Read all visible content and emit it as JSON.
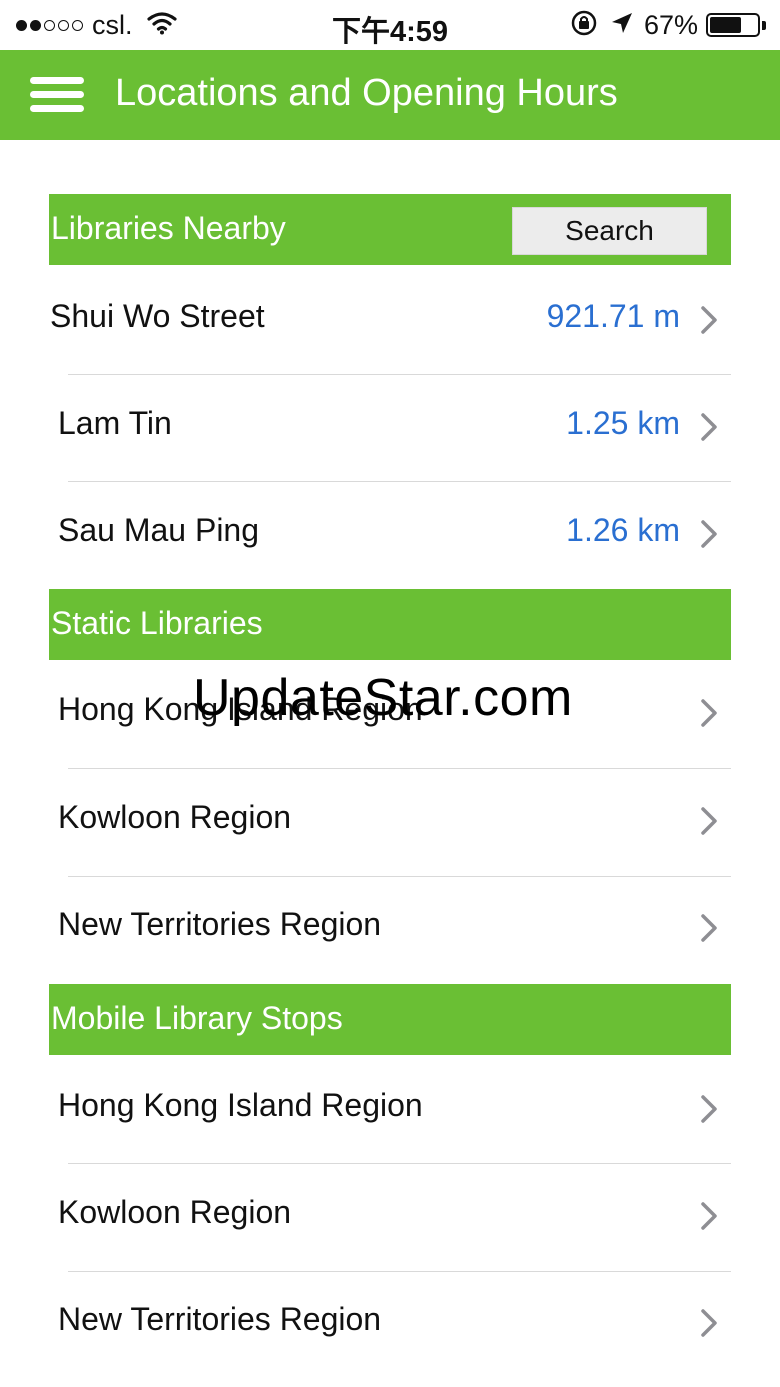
{
  "status_bar": {
    "carrier": "csl.",
    "time": "下午4:59",
    "battery": "67%",
    "battery_level": 0.67,
    "icons": [
      "signal-dots-icon",
      "wifi-icon",
      "rotation-lock-icon",
      "location-arrow-icon",
      "battery-icon"
    ]
  },
  "nav": {
    "title": "Locations and Opening Hours",
    "menu_icon": "hamburger-menu-icon"
  },
  "nearby": {
    "header": "Libraries Nearby",
    "search_label": "Search",
    "items": [
      {
        "name": "Shui Wo Street",
        "distance": "921.71 m"
      },
      {
        "name": "Lam Tin",
        "distance": "1.25 km"
      },
      {
        "name": "Sau Mau Ping",
        "distance": "1.26 km"
      }
    ]
  },
  "static": {
    "header": "Static Libraries",
    "items": [
      {
        "name": "Hong Kong Island Region"
      },
      {
        "name": "Kowloon Region"
      },
      {
        "name": "New Territories Region"
      }
    ]
  },
  "mobile": {
    "header": "Mobile Library Stops",
    "items": [
      {
        "name": "Hong Kong Island Region"
      },
      {
        "name": "Kowloon Region"
      },
      {
        "name": "New Territories Region"
      }
    ]
  },
  "watermark": "UpdateStar.com",
  "colors": {
    "accent": "#6abf34",
    "distance": "#2a6fd1",
    "chevron": "#8e8e93"
  }
}
